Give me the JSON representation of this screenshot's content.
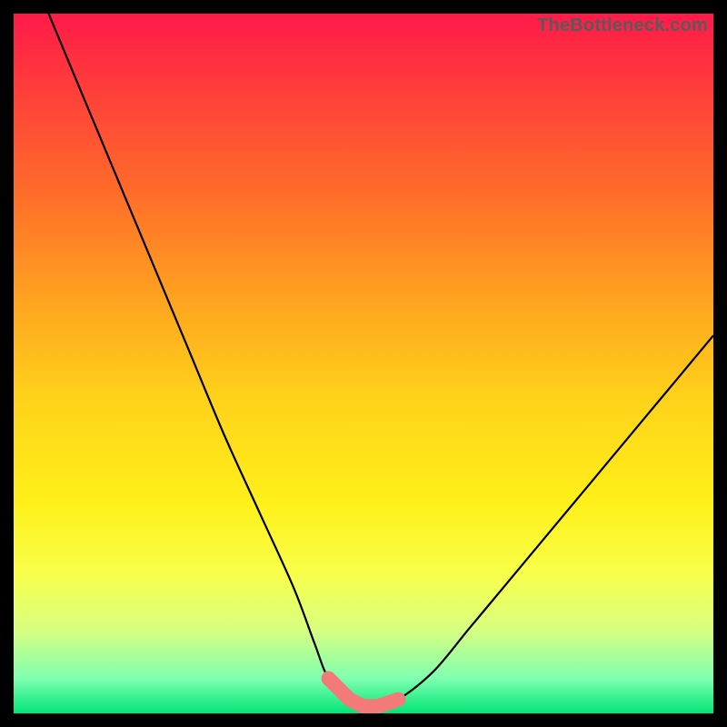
{
  "watermark": "TheBottleneck.com",
  "chart_data": {
    "type": "line",
    "title": "",
    "xlabel": "",
    "ylabel": "",
    "xlim": [
      0,
      100
    ],
    "ylim": [
      0,
      100
    ],
    "series": [
      {
        "name": "bottleneck-curve",
        "x": [
          5,
          10,
          15,
          20,
          25,
          30,
          35,
          40,
          43,
          45,
          48,
          50,
          52,
          55,
          60,
          65,
          70,
          75,
          80,
          85,
          90,
          95,
          100
        ],
        "values": [
          100,
          88,
          76,
          64,
          52,
          40,
          29,
          18,
          10,
          5,
          2,
          1,
          1,
          2,
          6,
          12,
          18,
          24,
          30,
          36,
          42,
          48,
          54
        ]
      }
    ],
    "annotations": [
      {
        "name": "trough-marker",
        "x_range": [
          42,
          55
        ],
        "y_range": [
          0,
          8
        ],
        "color": "#f47a7a"
      }
    ],
    "background": "rainbow-vertical-gradient"
  }
}
